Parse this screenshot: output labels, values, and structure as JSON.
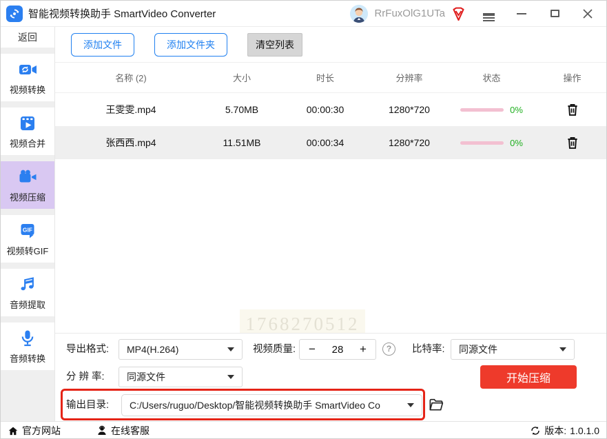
{
  "titlebar": {
    "app_title": "智能视频转换助手 SmartVideo Converter",
    "username": "RrFuxOlG1UTa"
  },
  "sidebar": {
    "back_label": "返回",
    "items": [
      {
        "label": "视频转换",
        "icon": "video-convert-icon"
      },
      {
        "label": "视频合并",
        "icon": "video-merge-icon"
      },
      {
        "label": "视频压缩",
        "icon": "video-compress-icon",
        "selected": true
      },
      {
        "label": "视频转GIF",
        "icon": "video-to-gif-icon"
      },
      {
        "label": "音频提取",
        "icon": "audio-extract-icon"
      },
      {
        "label": "音频转换",
        "icon": "audio-convert-icon"
      }
    ]
  },
  "toolbar": {
    "add_file_label": "添加文件",
    "add_folder_label": "添加文件夹",
    "clear_list_label": "清空列表"
  },
  "table": {
    "headers": {
      "name": "名称 (2)",
      "size": "大小",
      "duration": "时长",
      "resolution": "分辨率",
      "status": "状态",
      "action": "操作"
    },
    "rows": [
      {
        "name": "王雯雯.mp4",
        "size": "5.70MB",
        "duration": "00:00:30",
        "resolution": "1280*720",
        "progress": "0%"
      },
      {
        "name": "张西西.mp4",
        "size": "11.51MB",
        "duration": "00:00:34",
        "resolution": "1280*720",
        "progress": "0%"
      }
    ]
  },
  "watermark": "1768270512",
  "settings": {
    "export_format_label": "导出格式:",
    "export_format_value": "MP4(H.264)",
    "video_quality_label": "视频质量:",
    "video_quality_value": "28",
    "minus_label": "−",
    "plus_label": "+",
    "help_label": "?",
    "bitrate_label": "比特率:",
    "bitrate_value": "同源文件",
    "resolution_label": "分 辨 率:",
    "resolution_value": "同源文件",
    "start_button_label": "开始压缩",
    "output_dir_label": "输出目录:",
    "output_dir_value": "C:/Users/ruguo/Desktop/智能视频转换助手 SmartVideo Co"
  },
  "footer": {
    "website_label": "官方网站",
    "support_label": "在线客服",
    "version_label": "版本:",
    "version_value": "1.0.1.0"
  },
  "colors": {
    "accent_blue": "#2080f0",
    "icon_blue": "#2b7ff0",
    "selected_nav_bg": "#d9c8f2",
    "progress_pink": "#f3c0d1",
    "progress_green": "#1faf1f",
    "start_button_red": "#ee3a2b",
    "annotation_red": "#e52417",
    "alt_row_gray": "#efefef"
  },
  "icons": {
    "app": "app-logo-icon",
    "vip": "vip-badge-icon",
    "menu": "hamburger-menu-icon",
    "window": [
      "minimize-icon",
      "maximize-icon",
      "close-icon"
    ],
    "row_action": "trash-icon",
    "output": "folder-icon",
    "footer": [
      "home-icon",
      "customer-service-icon",
      "refresh-icon"
    ]
  }
}
